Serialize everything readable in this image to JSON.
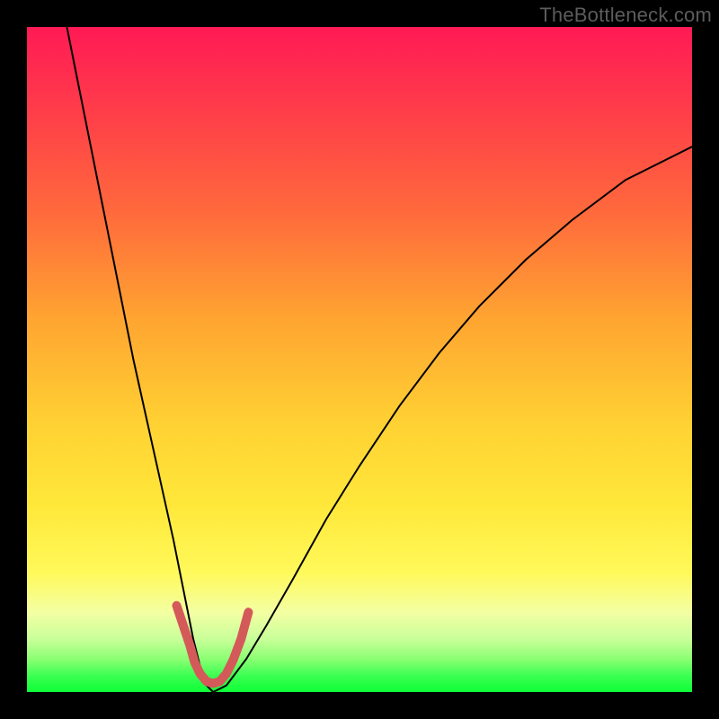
{
  "watermark": "TheBottleneck.com",
  "chart_data": {
    "type": "line",
    "title": "",
    "xlabel": "",
    "ylabel": "",
    "xlim": [
      0,
      100
    ],
    "ylim": [
      0,
      100
    ],
    "grid": false,
    "legend": false,
    "notes": "Axes are unlabeled; values are estimated pixel-relative percentages of the plot area (0,0 = bottom-left, 100,100 = top-right).",
    "series": [
      {
        "name": "black_curve",
        "color": "#000000",
        "stroke_width": 2,
        "x": [
          6,
          8,
          10,
          12,
          14,
          16,
          18,
          20,
          22,
          24,
          25,
          26,
          27,
          28,
          30,
          33,
          36,
          40,
          45,
          50,
          56,
          62,
          68,
          75,
          82,
          90,
          100
        ],
        "y": [
          100,
          90,
          80,
          70,
          60,
          50,
          41,
          32,
          23,
          13,
          8,
          4,
          1,
          0,
          1,
          5,
          10,
          17,
          26,
          34,
          43,
          51,
          58,
          65,
          71,
          77,
          82
        ]
      },
      {
        "name": "red_bracket",
        "color": "#d45a5a",
        "stroke_width": 10,
        "linecap": "round",
        "x": [
          22.5,
          23.5,
          24.5,
          25.2,
          26.0,
          27.0,
          28.0,
          29.0,
          30.0,
          31.0,
          32.2,
          33.3
        ],
        "y": [
          13.0,
          10.0,
          7.0,
          4.5,
          2.8,
          1.6,
          1.3,
          1.6,
          2.8,
          4.8,
          8.0,
          12.0
        ]
      }
    ],
    "background_gradient_stops": [
      {
        "pos": 0.0,
        "color": "#ff1a55"
      },
      {
        "pos": 0.12,
        "color": "#ff3b4a"
      },
      {
        "pos": 0.28,
        "color": "#ff6a3c"
      },
      {
        "pos": 0.44,
        "color": "#ffa531"
      },
      {
        "pos": 0.6,
        "color": "#ffd233"
      },
      {
        "pos": 0.72,
        "color": "#ffe83a"
      },
      {
        "pos": 0.82,
        "color": "#fff95a"
      },
      {
        "pos": 0.88,
        "color": "#f4ffa3"
      },
      {
        "pos": 0.92,
        "color": "#c9ff9a"
      },
      {
        "pos": 0.95,
        "color": "#8cff73"
      },
      {
        "pos": 0.975,
        "color": "#3dff53"
      },
      {
        "pos": 1.0,
        "color": "#0cff36"
      }
    ]
  }
}
